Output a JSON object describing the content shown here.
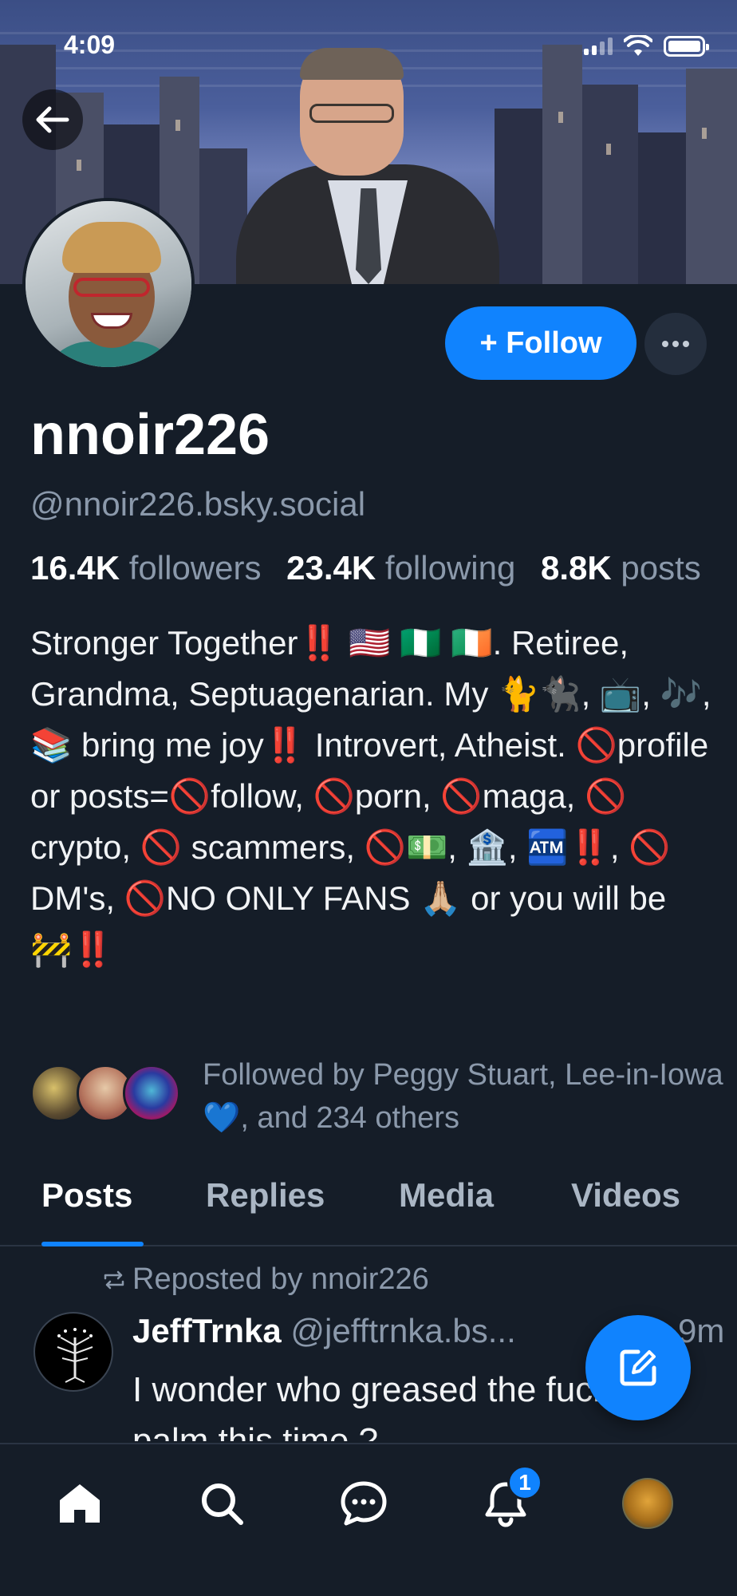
{
  "status_bar": {
    "time": "4:09"
  },
  "profile": {
    "display_name": "nnoir226",
    "handle": "@nnoir226.bsky.social",
    "follow_label": "+ Follow",
    "stats": [
      {
        "value": "16.4K",
        "label": "followers"
      },
      {
        "value": "23.4K",
        "label": "following"
      },
      {
        "value": "8.8K",
        "label": "posts"
      }
    ],
    "bio": "Stronger Together‼️ 🇺🇸 🇳🇬 🇮🇪. Retiree, Grandma, Septuagenarian. My 🐈🐈‍⬛, 📺, 🎶, 📚 bring me joy‼️ Introvert, Atheist. 🚫profile or posts=🚫follow, 🚫porn, 🚫maga, 🚫crypto, 🚫 scammers, 🚫💵, 🏦, 🏧‼️, 🚫 DM's, 🚫NO ONLY FANS 🙏🏼 or you will be 🚧‼️",
    "followed_by": "Followed by Peggy Stuart, Lee-in-Iowa 💙, and 234 others"
  },
  "tabs": [
    "Posts",
    "Replies",
    "Media",
    "Videos"
  ],
  "post": {
    "repost_label": "Reposted by nnoir226",
    "author": "JeffTrnka",
    "handle": "@jefftrnka.bs...",
    "time": "9m",
    "text": "I wonder who greased the fuck's palm this time ?"
  },
  "notifications": {
    "badge_count": "1"
  },
  "colors": {
    "accent": "#1083fe",
    "background": "#151d28",
    "muted": "#8b99ab"
  }
}
